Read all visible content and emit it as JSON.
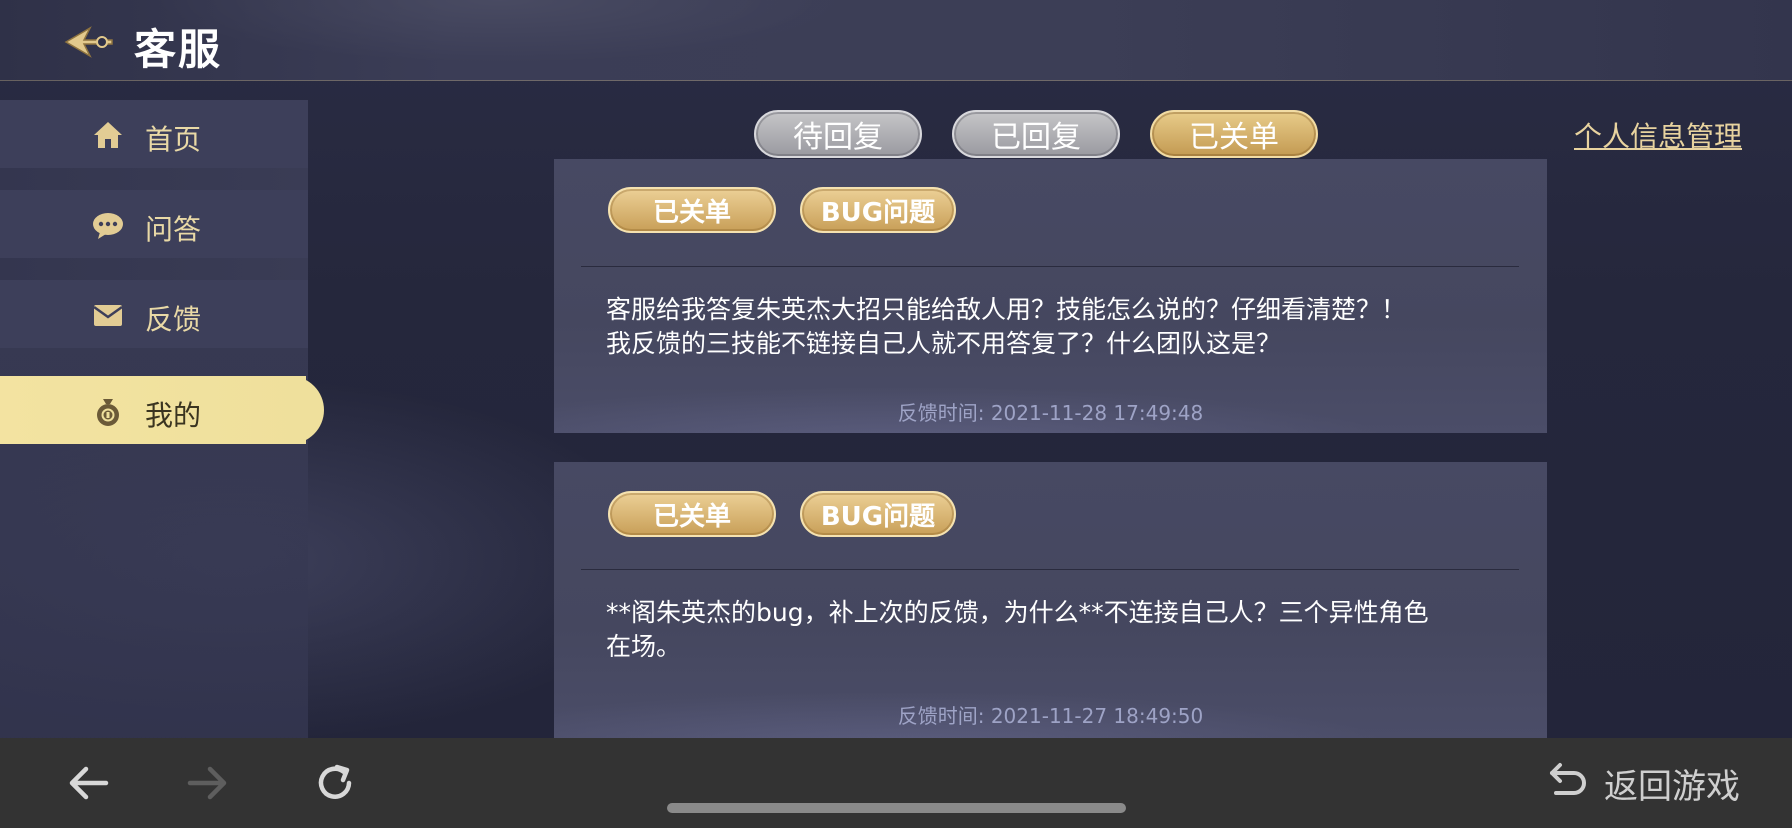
{
  "header": {
    "title": "客服",
    "back_icon": "ornate-back-arrow-icon"
  },
  "sidebar": {
    "items": [
      {
        "label": "首页",
        "icon": "home-icon",
        "active": false
      },
      {
        "label": "问答",
        "icon": "chat-bubble-icon",
        "active": false
      },
      {
        "label": "反馈",
        "icon": "envelope-icon",
        "active": false
      },
      {
        "label": "我的",
        "icon": "money-bag-icon",
        "active": true
      }
    ]
  },
  "tabs": [
    {
      "label": "待回复",
      "active": false
    },
    {
      "label": "已回复",
      "active": false
    },
    {
      "label": "已关单",
      "active": true
    }
  ],
  "profile_link": "个人信息管理",
  "feedback": [
    {
      "status": "已关单",
      "category": "BUG问题",
      "text_line1": "客服给我答复朱英杰大招只能给敌人用？技能怎么说的？仔细看清楚？！",
      "text_line2": "我反馈的三技能不链接自己人就不用答复了？什么团队这是？",
      "time": "反馈时间: 2021-11-28 17:49:48"
    },
    {
      "status": "已关单",
      "category": "BUG问题",
      "text_line1": "**阁朱英杰的bug，补上次的反馈，为什么**不连接自己人？三个异性角色",
      "text_line2": "在场。",
      "time": "反馈时间: 2021-11-27 18:49:50"
    }
  ],
  "bottom_bar": {
    "back_icon": "arrow-left-icon",
    "forward_icon": "arrow-right-icon",
    "reload_icon": "reload-icon",
    "return_icon": "return-arrow-icon",
    "return_label": "返回游戏"
  },
  "colors": {
    "gold_text": "#e8d39f",
    "active_tab": "#d6b46f",
    "sidebar_active": "#f3e3a1"
  }
}
